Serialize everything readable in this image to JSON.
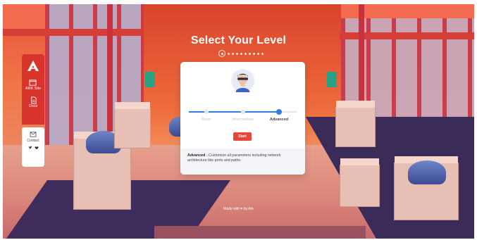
{
  "page": {
    "title": "Select Your Level",
    "level_steps": 10,
    "active_step": 1
  },
  "sidebar": {
    "items": [
      {
        "label": "ARK Site",
        "icon": "window-icon"
      },
      {
        "label": "Docs",
        "icon": "document-icon"
      }
    ],
    "contact_label": "Contact",
    "social": [
      "twitter-icon",
      "heart-icon"
    ]
  },
  "card": {
    "levels": [
      {
        "label": "Basic",
        "state": "inactive"
      },
      {
        "label": "Intermediate",
        "state": "inactive"
      },
      {
        "label": "Advanced",
        "state": "selected"
      }
    ],
    "progress_fraction": 1.0,
    "start_label": "Start",
    "description_title": "Advanced",
    "description_text": "- Customize all parameters including network architecture like ports and paths."
  },
  "footer": {
    "text": "Made with ♥ by Ark"
  },
  "colors": {
    "accent": "#e8463a",
    "progress": "#2f7de1",
    "sidebar": "#d9342c"
  }
}
